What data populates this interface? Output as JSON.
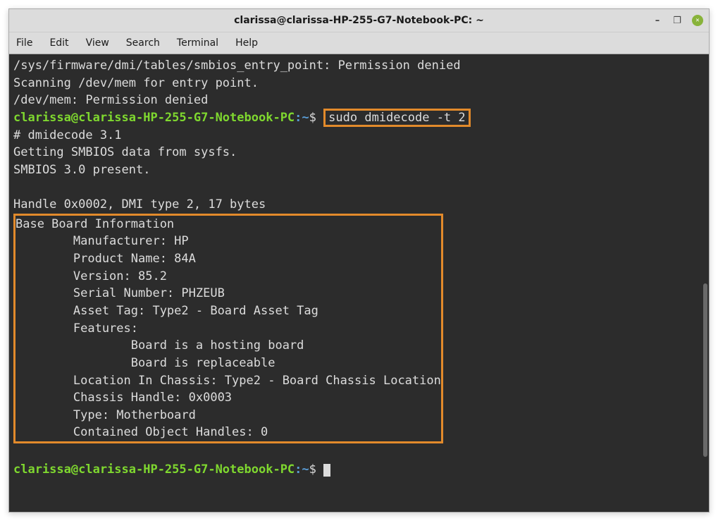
{
  "window": {
    "title": "clarissa@clarissa-HP-255-G7-Notebook-PC: ~"
  },
  "menubar": {
    "items": [
      "File",
      "Edit",
      "View",
      "Search",
      "Terminal",
      "Help"
    ]
  },
  "terminal": {
    "pre_lines": [
      "/sys/firmware/dmi/tables/smbios_entry_point: Permission denied",
      "Scanning /dev/mem for entry point.",
      "/dev/mem: Permission denied"
    ],
    "prompt": {
      "user": "clarissa@clarissa-HP-255-G7-Notebook-PC",
      "sep": ":",
      "path": "~",
      "dollar": "$"
    },
    "command": "sudo dmidecode -t 2",
    "output_pre": [
      "# dmidecode 3.1",
      "Getting SMBIOS data from sysfs.",
      "SMBIOS 3.0 present.",
      "",
      "Handle 0x0002, DMI type 2, 17 bytes"
    ],
    "boxed_output": [
      "Base Board Information",
      "        Manufacturer: HP",
      "        Product Name: 84A",
      "        Version: 85.2",
      "        Serial Number: PHZEUB",
      "        Asset Tag: Type2 - Board Asset Tag",
      "        Features:",
      "                Board is a hosting board",
      "                Board is replaceable",
      "        Location In Chassis: Type2 - Board Chassis Location",
      "        Chassis Handle: 0x0003",
      "        Type: Motherboard",
      "        Contained Object Handles: 0"
    ]
  }
}
